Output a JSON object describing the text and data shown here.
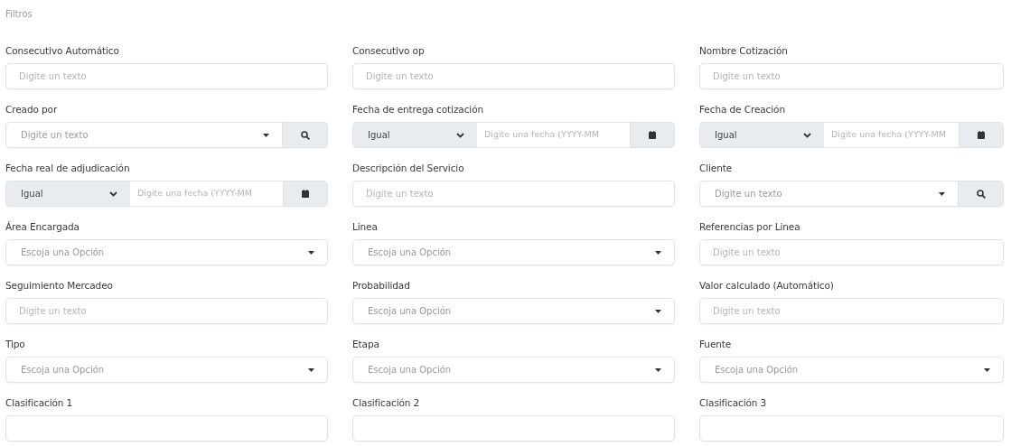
{
  "heading": "Filtros",
  "fields": [
    {
      "label": "Consecutivo Automático",
      "kind": "text",
      "placeholder": "Digite un texto"
    },
    {
      "label": "Consecutivo op",
      "kind": "text",
      "placeholder": "Digite un texto"
    },
    {
      "label": "Nombre Cotización",
      "kind": "text",
      "placeholder": "Digite un texto"
    },
    {
      "label": "Creado por",
      "kind": "search",
      "placeholder": "Digite un texto"
    },
    {
      "label": "Fecha de entrega cotización",
      "kind": "date",
      "operator": "Igual",
      "placeholder": "Digite una fecha (YYYY-MM"
    },
    {
      "label": "Fecha de Creación",
      "kind": "date",
      "operator": "Igual",
      "placeholder": "Digite una fecha (YYYY-MM"
    },
    {
      "label": "Fecha real de adjudicación",
      "kind": "date",
      "operator": "Igual",
      "placeholder": "Digite una fecha (YYYY-MM"
    },
    {
      "label": "Descripción del Servicio",
      "kind": "text",
      "placeholder": "Digite un texto"
    },
    {
      "label": "Cliente",
      "kind": "search",
      "placeholder": "Digite un texto"
    },
    {
      "label": "Área Encargada",
      "kind": "select",
      "placeholder": "Escoja una Opción"
    },
    {
      "label": "Linea",
      "kind": "select",
      "placeholder": "Escoja una Opción"
    },
    {
      "label": "Referencias por Linea",
      "kind": "text",
      "placeholder": "Digite un texto"
    },
    {
      "label": "Seguimiento Mercadeo",
      "kind": "text",
      "placeholder": "Digite un texto"
    },
    {
      "label": "Probabilidad",
      "kind": "select",
      "placeholder": "Escoja una Opción"
    },
    {
      "label": "Valor calculado (Automático)",
      "kind": "text",
      "placeholder": "Digite un texto"
    },
    {
      "label": "Tipo",
      "kind": "select",
      "placeholder": "Escoja una Opción"
    },
    {
      "label": "Etapa",
      "kind": "select",
      "placeholder": "Escoja una Opción"
    },
    {
      "label": "Fuente",
      "kind": "select",
      "placeholder": "Escoja una Opción"
    },
    {
      "label": "Clasificación 1",
      "kind": "blank"
    },
    {
      "label": "Clasificación 2",
      "kind": "blank"
    },
    {
      "label": "Clasificación 3",
      "kind": "blank"
    }
  ]
}
